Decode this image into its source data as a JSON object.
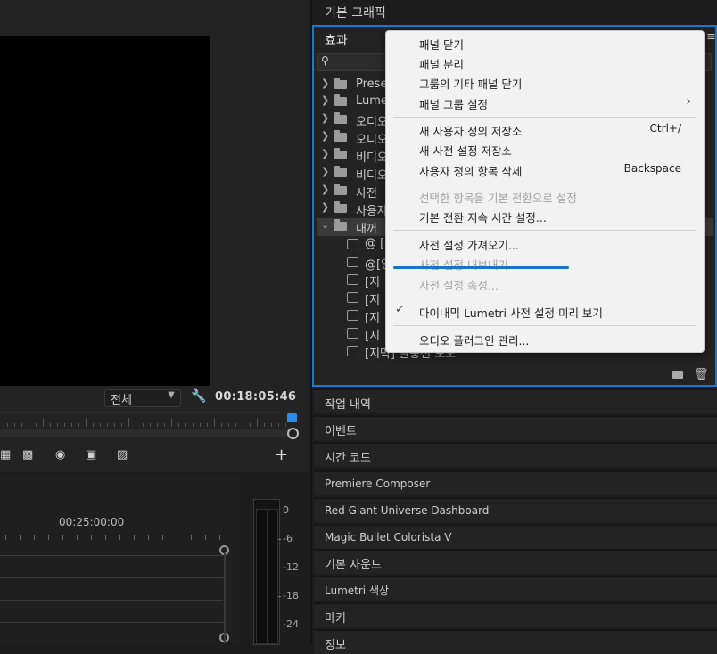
{
  "monitor": {
    "zoom": "전체",
    "timecode": "00:18:05:46"
  },
  "timeline": {
    "time_label": "00:25:00:00"
  },
  "meter": {
    "db_labels": [
      "0",
      "-6",
      "-12",
      "-18",
      "-24"
    ]
  },
  "panels": {
    "basic_graphics": "기본 그래픽",
    "effects_title": "효과",
    "below": [
      "작업 내역",
      "이벤트",
      "시간 코드",
      "Premiere Composer",
      "Red Giant Universe Dashboard",
      "Magic Bullet Colorista V",
      "기본 사운드",
      "Lumetri 색상",
      "마커",
      "정보"
    ]
  },
  "effects_tree": {
    "folders": [
      "Prese",
      "Lumet",
      "오디오",
      "오디오",
      "비디오",
      "비디오",
      "사전 ",
      "사용자",
      "내꺼 "
    ],
    "children": [
      "@ [",
      "@[양",
      "[지",
      "[지",
      "[지",
      "[지",
      "[지",
      "[지막] 말풍선 보도"
    ]
  },
  "menu": {
    "items": [
      {
        "label": "패널 닫기"
      },
      {
        "label": "패널 분리"
      },
      {
        "label": "그룹의 기타 패널 닫기"
      },
      {
        "label": "패널 그룹 설정",
        "submenu": true
      },
      {
        "label": "새 사용자 정의 저장소",
        "shortcut": "Ctrl+/"
      },
      {
        "label": "새 사전 설정 저장소"
      },
      {
        "label": "사용자 정의 항목 삭제",
        "shortcut": "Backspace"
      },
      {
        "label": "선택한 항목을 기본 전환으로 설정",
        "disabled": true
      },
      {
        "label": "기본 전환 지속 시간 설정..."
      },
      {
        "label": "사전 설정 가져오기..."
      },
      {
        "label": "사전 설정 내보내기...",
        "disabled": true
      },
      {
        "label": "사전 설정 속성...",
        "disabled": true
      },
      {
        "label": "다이내믹 Lumetri 사전 설정 미리 보기",
        "checked": true
      },
      {
        "label": "오디오 플러그인 관리..."
      }
    ]
  },
  "colors": {
    "highlight_border": "#1b77d0",
    "annotation_line": "#1a73c8",
    "playhead": "#2d8ceb"
  }
}
